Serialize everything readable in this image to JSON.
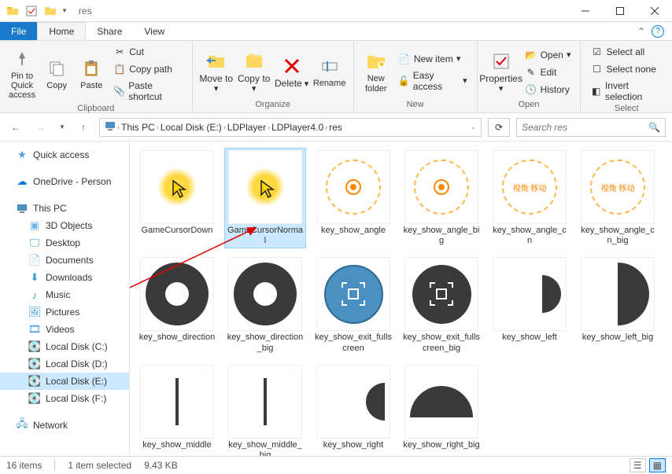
{
  "titlebar": {
    "title": "res"
  },
  "tabs": {
    "file": "File",
    "home": "Home",
    "share": "Share",
    "view": "View"
  },
  "ribbon": {
    "clipboard": {
      "label": "Clipboard",
      "pin": "Pin to Quick access",
      "copy": "Copy",
      "paste": "Paste",
      "cut": "Cut",
      "copypath": "Copy path",
      "shortcut": "Paste shortcut"
    },
    "organize": {
      "label": "Organize",
      "moveto": "Move to",
      "copyto": "Copy to",
      "delete": "Delete",
      "rename": "Rename"
    },
    "new": {
      "label": "New",
      "newfolder": "New folder",
      "newitem": "New item",
      "easyaccess": "Easy access"
    },
    "open": {
      "label": "Open",
      "properties": "Properties",
      "open": "Open",
      "edit": "Edit",
      "history": "History"
    },
    "select": {
      "label": "Select",
      "selectall": "Select all",
      "selectnone": "Select none",
      "invert": "Invert selection"
    }
  },
  "breadcrumb": {
    "thispc": "This PC",
    "drive": "Local Disk (E:)",
    "p1": "LDPlayer",
    "p2": "LDPlayer4.0",
    "p3": "res"
  },
  "search": {
    "placeholder": "Search res"
  },
  "sidebar": {
    "quickaccess": "Quick access",
    "onedrive": "OneDrive - Person",
    "thispc": "This PC",
    "objects3d": "3D Objects",
    "desktop": "Desktop",
    "documents": "Documents",
    "downloads": "Downloads",
    "music": "Music",
    "pictures": "Pictures",
    "videos": "Videos",
    "diskc": "Local Disk (C:)",
    "diskd": "Local Disk (D:)",
    "diske": "Local Disk (E:)",
    "diskf": "Local Disk (F:)",
    "network": "Network"
  },
  "files": [
    {
      "name": "GameCursorDown",
      "kind": "cursor"
    },
    {
      "name": "GameCursorNormal",
      "kind": "cursor",
      "selected": true
    },
    {
      "name": "key_show_angle",
      "kind": "angle"
    },
    {
      "name": "key_show_angle_big",
      "kind": "angle"
    },
    {
      "name": "key_show_angle_cn",
      "kind": "angle-cn"
    },
    {
      "name": "key_show_angle_cn_big",
      "kind": "angle-cn"
    },
    {
      "name": "key_show_direction",
      "kind": "ring"
    },
    {
      "name": "key_show_direction_big",
      "kind": "ring"
    },
    {
      "name": "key_show_exit_fullscreen",
      "kind": "exitfs"
    },
    {
      "name": "key_show_exit_fullscreen_big",
      "kind": "exitfs-big"
    },
    {
      "name": "key_show_left",
      "kind": "half-right"
    },
    {
      "name": "key_show_left_big",
      "kind": "half-right-big"
    },
    {
      "name": "key_show_middle",
      "kind": "stick"
    },
    {
      "name": "key_show_middle_big",
      "kind": "stick"
    },
    {
      "name": "key_show_right",
      "kind": "half-left-small"
    },
    {
      "name": "key_show_right_big",
      "kind": "half-top"
    }
  ],
  "angle_cn_text": "视角\n移动",
  "status": {
    "count": "16 items",
    "selected": "1 item selected",
    "size": "9.43 KB"
  }
}
